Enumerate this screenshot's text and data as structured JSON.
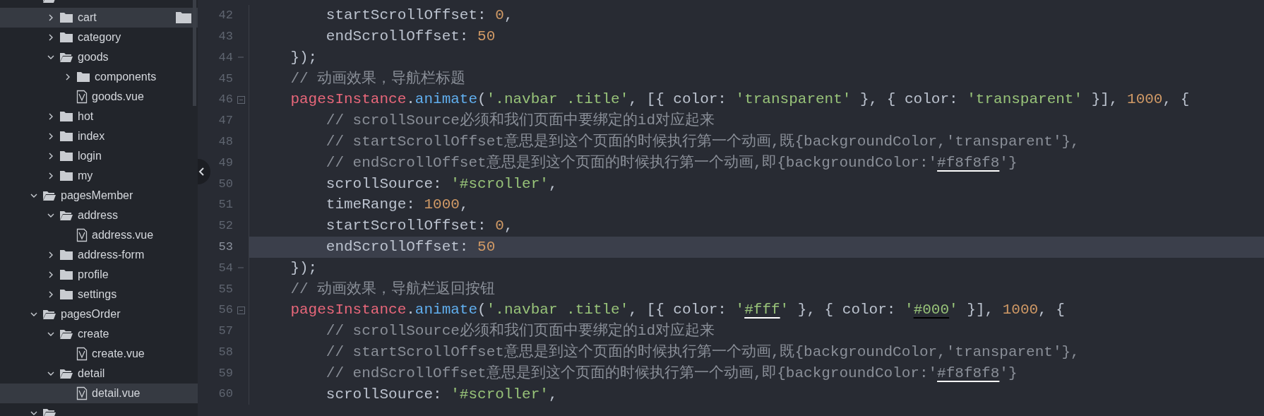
{
  "file_tree": [
    {
      "kind": "folder",
      "expanded": true,
      "selected": false,
      "children": [
        {
          "name": "cart",
          "kind": "folder",
          "expanded": false,
          "selected": true
        },
        {
          "name": "category",
          "kind": "folder",
          "expanded": false,
          "selected": false
        },
        {
          "name": "goods",
          "kind": "folder",
          "expanded": true,
          "selected": false,
          "children": [
            {
              "name": "components",
              "kind": "folder",
              "expanded": false,
              "selected": false
            },
            {
              "name": "goods.vue",
              "kind": "file",
              "selected": false
            }
          ]
        },
        {
          "name": "hot",
          "kind": "folder",
          "expanded": false,
          "selected": false
        },
        {
          "name": "index",
          "kind": "folder",
          "expanded": false,
          "selected": false
        },
        {
          "name": "login",
          "kind": "folder",
          "expanded": false,
          "selected": false
        },
        {
          "name": "my",
          "kind": "folder",
          "expanded": false,
          "selected": false
        }
      ]
    },
    {
      "name": "pagesMember",
      "kind": "folder",
      "expanded": true,
      "selected": false,
      "children": [
        {
          "name": "address",
          "kind": "folder",
          "expanded": true,
          "selected": false,
          "children": [
            {
              "name": "address.vue",
              "kind": "file",
              "selected": false
            }
          ]
        },
        {
          "name": "address-form",
          "kind": "folder",
          "expanded": false,
          "selected": false
        },
        {
          "name": "profile",
          "kind": "folder",
          "expanded": false,
          "selected": false
        },
        {
          "name": "settings",
          "kind": "folder",
          "expanded": false,
          "selected": false
        }
      ]
    },
    {
      "name": "pagesOrder",
      "kind": "folder",
      "expanded": true,
      "selected": false,
      "children": [
        {
          "name": "create",
          "kind": "folder",
          "expanded": true,
          "selected": false,
          "children": [
            {
              "name": "create.vue",
              "kind": "file",
              "selected": false
            }
          ]
        },
        {
          "name": "detail",
          "kind": "folder",
          "expanded": true,
          "selected": false,
          "children": [
            {
              "name": "detail.vue",
              "kind": "file",
              "selected": true
            }
          ]
        }
      ]
    },
    {
      "kind": "folder",
      "expanded": true,
      "selected": false
    }
  ],
  "editor": {
    "lines": [
      {
        "number": "42",
        "current": false,
        "foldable": false,
        "block_end": false,
        "tokens": [
          {
            "kind": "plain",
            "text": "        startScrollOffset: "
          },
          {
            "kind": "number",
            "text": "0"
          },
          {
            "kind": "plain",
            "text": ","
          }
        ]
      },
      {
        "number": "43",
        "current": false,
        "foldable": false,
        "block_end": false,
        "tokens": [
          {
            "kind": "plain",
            "text": "        endScrollOffset: "
          },
          {
            "kind": "number",
            "text": "50"
          }
        ]
      },
      {
        "number": "44",
        "current": false,
        "foldable": false,
        "block_end": true,
        "tokens": [
          {
            "kind": "plain",
            "text": "    });"
          }
        ]
      },
      {
        "number": "45",
        "current": false,
        "foldable": false,
        "block_end": false,
        "tokens": [
          {
            "kind": "comment",
            "text": "    // 动画效果，导航栏标题"
          }
        ]
      },
      {
        "number": "46",
        "current": false,
        "foldable": true,
        "block_end": false,
        "tokens": [
          {
            "kind": "object",
            "text": "    pagesInstance"
          },
          {
            "kind": "plain",
            "text": "."
          },
          {
            "kind": "method",
            "text": "animate"
          },
          {
            "kind": "plain",
            "text": "("
          },
          {
            "kind": "string",
            "text": "'.navbar .title'"
          },
          {
            "kind": "plain",
            "text": ", [{ color: "
          },
          {
            "kind": "string",
            "text": "'transparent'"
          },
          {
            "kind": "plain",
            "text": " }, { color: "
          },
          {
            "kind": "string",
            "text": "'transparent'"
          },
          {
            "kind": "plain",
            "text": " }], "
          },
          {
            "kind": "number",
            "text": "1000"
          },
          {
            "kind": "plain",
            "text": ", {"
          }
        ]
      },
      {
        "number": "47",
        "current": false,
        "foldable": false,
        "block_end": false,
        "tokens": [
          {
            "kind": "comment",
            "text": "        // scrollSource必须和我们页面中要绑定的id对应起来"
          }
        ]
      },
      {
        "number": "48",
        "current": false,
        "foldable": false,
        "block_end": false,
        "tokens": [
          {
            "kind": "comment",
            "text": "        // startScrollOffset意思是到这个页面的时候执行第一个动画,既{backgroundColor,'transparent'},"
          }
        ]
      },
      {
        "number": "49",
        "current": false,
        "foldable": false,
        "block_end": false,
        "tokens": [
          {
            "kind": "comment",
            "text": "        // endScrollOffset意思是到这个页面的时候执行第一个动画,即{backgroundColor:'"
          },
          {
            "kind": "comment",
            "text": "#f8f8f8",
            "color": "#ffffff"
          },
          {
            "kind": "comment",
            "text": "'}"
          }
        ]
      },
      {
        "number": "50",
        "current": false,
        "foldable": false,
        "block_end": false,
        "tokens": [
          {
            "kind": "plain",
            "text": "        scrollSource: "
          },
          {
            "kind": "string",
            "text": "'#scroller'"
          },
          {
            "kind": "plain",
            "text": ","
          }
        ]
      },
      {
        "number": "51",
        "current": false,
        "foldable": false,
        "block_end": false,
        "tokens": [
          {
            "kind": "plain",
            "text": "        timeRange: "
          },
          {
            "kind": "number",
            "text": "1000"
          },
          {
            "kind": "plain",
            "text": ","
          }
        ]
      },
      {
        "number": "52",
        "current": false,
        "foldable": false,
        "block_end": false,
        "tokens": [
          {
            "kind": "plain",
            "text": "        startScrollOffset: "
          },
          {
            "kind": "number",
            "text": "0"
          },
          {
            "kind": "plain",
            "text": ","
          }
        ]
      },
      {
        "number": "53",
        "current": true,
        "foldable": false,
        "block_end": false,
        "tokens": [
          {
            "kind": "plain",
            "text": "        endScrollOffset: "
          },
          {
            "kind": "number",
            "text": "50"
          }
        ]
      },
      {
        "number": "54",
        "current": false,
        "foldable": false,
        "block_end": true,
        "tokens": [
          {
            "kind": "plain",
            "text": "    });"
          }
        ]
      },
      {
        "number": "55",
        "current": false,
        "foldable": false,
        "block_end": false,
        "tokens": [
          {
            "kind": "comment",
            "text": "    // 动画效果，导航栏返回按钮"
          }
        ]
      },
      {
        "number": "56",
        "current": false,
        "foldable": true,
        "block_end": false,
        "tokens": [
          {
            "kind": "object",
            "text": "    pagesInstance"
          },
          {
            "kind": "plain",
            "text": "."
          },
          {
            "kind": "method",
            "text": "animate"
          },
          {
            "kind": "plain",
            "text": "("
          },
          {
            "kind": "string",
            "text": "'.navbar .title'"
          },
          {
            "kind": "plain",
            "text": ", [{ color: "
          },
          {
            "kind": "string",
            "text": "'"
          },
          {
            "kind": "string",
            "text": "#fff",
            "color": "#ffffff"
          },
          {
            "kind": "string",
            "text": "'"
          },
          {
            "kind": "plain",
            "text": " }, { color: "
          },
          {
            "kind": "string",
            "text": "'"
          },
          {
            "kind": "string",
            "text": "#000",
            "color": "#000000"
          },
          {
            "kind": "string",
            "text": "'"
          },
          {
            "kind": "plain",
            "text": " }], "
          },
          {
            "kind": "number",
            "text": "1000"
          },
          {
            "kind": "plain",
            "text": ", {"
          }
        ]
      },
      {
        "number": "57",
        "current": false,
        "foldable": false,
        "block_end": false,
        "tokens": [
          {
            "kind": "comment",
            "text": "        // scrollSource必须和我们页面中要绑定的id对应起来"
          }
        ]
      },
      {
        "number": "58",
        "current": false,
        "foldable": false,
        "block_end": false,
        "tokens": [
          {
            "kind": "comment",
            "text": "        // startScrollOffset意思是到这个页面的时候执行第一个动画,既{backgroundColor,'transparent'},"
          }
        ]
      },
      {
        "number": "59",
        "current": false,
        "foldable": false,
        "block_end": false,
        "tokens": [
          {
            "kind": "comment",
            "text": "        // endScrollOffset意思是到这个页面的时候执行第一个动画,即{backgroundColor:'"
          },
          {
            "kind": "comment",
            "text": "#f8f8f8",
            "color": "#ffffff"
          },
          {
            "kind": "comment",
            "text": "'}"
          }
        ]
      },
      {
        "number": "60",
        "current": false,
        "foldable": false,
        "block_end": false,
        "tokens": [
          {
            "kind": "plain",
            "text": "        scrollSource: "
          },
          {
            "kind": "string",
            "text": "'#scroller'"
          },
          {
            "kind": "plain",
            "text": ","
          }
        ]
      }
    ]
  }
}
